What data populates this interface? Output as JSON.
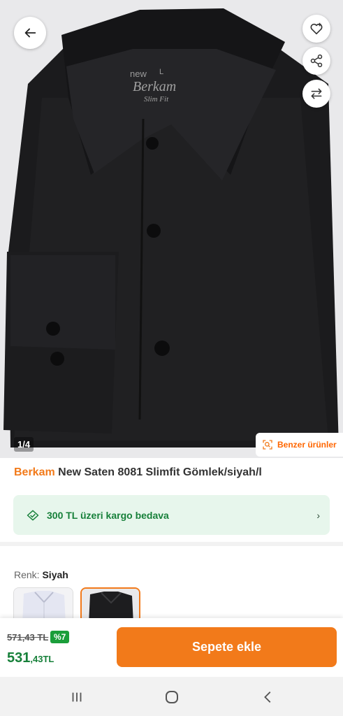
{
  "gallery": {
    "counter": "1/4",
    "similar_label": "Benzer ürünler",
    "shirt_tag": {
      "line1": "new",
      "size": "L",
      "brand": "Berkam",
      "fit": "Slim Fit"
    }
  },
  "product": {
    "brand": "Berkam",
    "name": "New Saten 8081 Slimfit Gömlek/siyah/l"
  },
  "cargo": {
    "text": "300 TL üzeri kargo bedava"
  },
  "color": {
    "label": "Renk:",
    "value": "Siyah"
  },
  "price": {
    "old": "571,43 TL",
    "discount": "%7",
    "new_main": "531",
    "new_cents": ",43TL"
  },
  "actions": {
    "add_to_cart": "Sepete ekle"
  },
  "colors": {
    "accent": "#f27a1a",
    "green": "#17803a",
    "cargo_bg": "#e7f6ec"
  }
}
